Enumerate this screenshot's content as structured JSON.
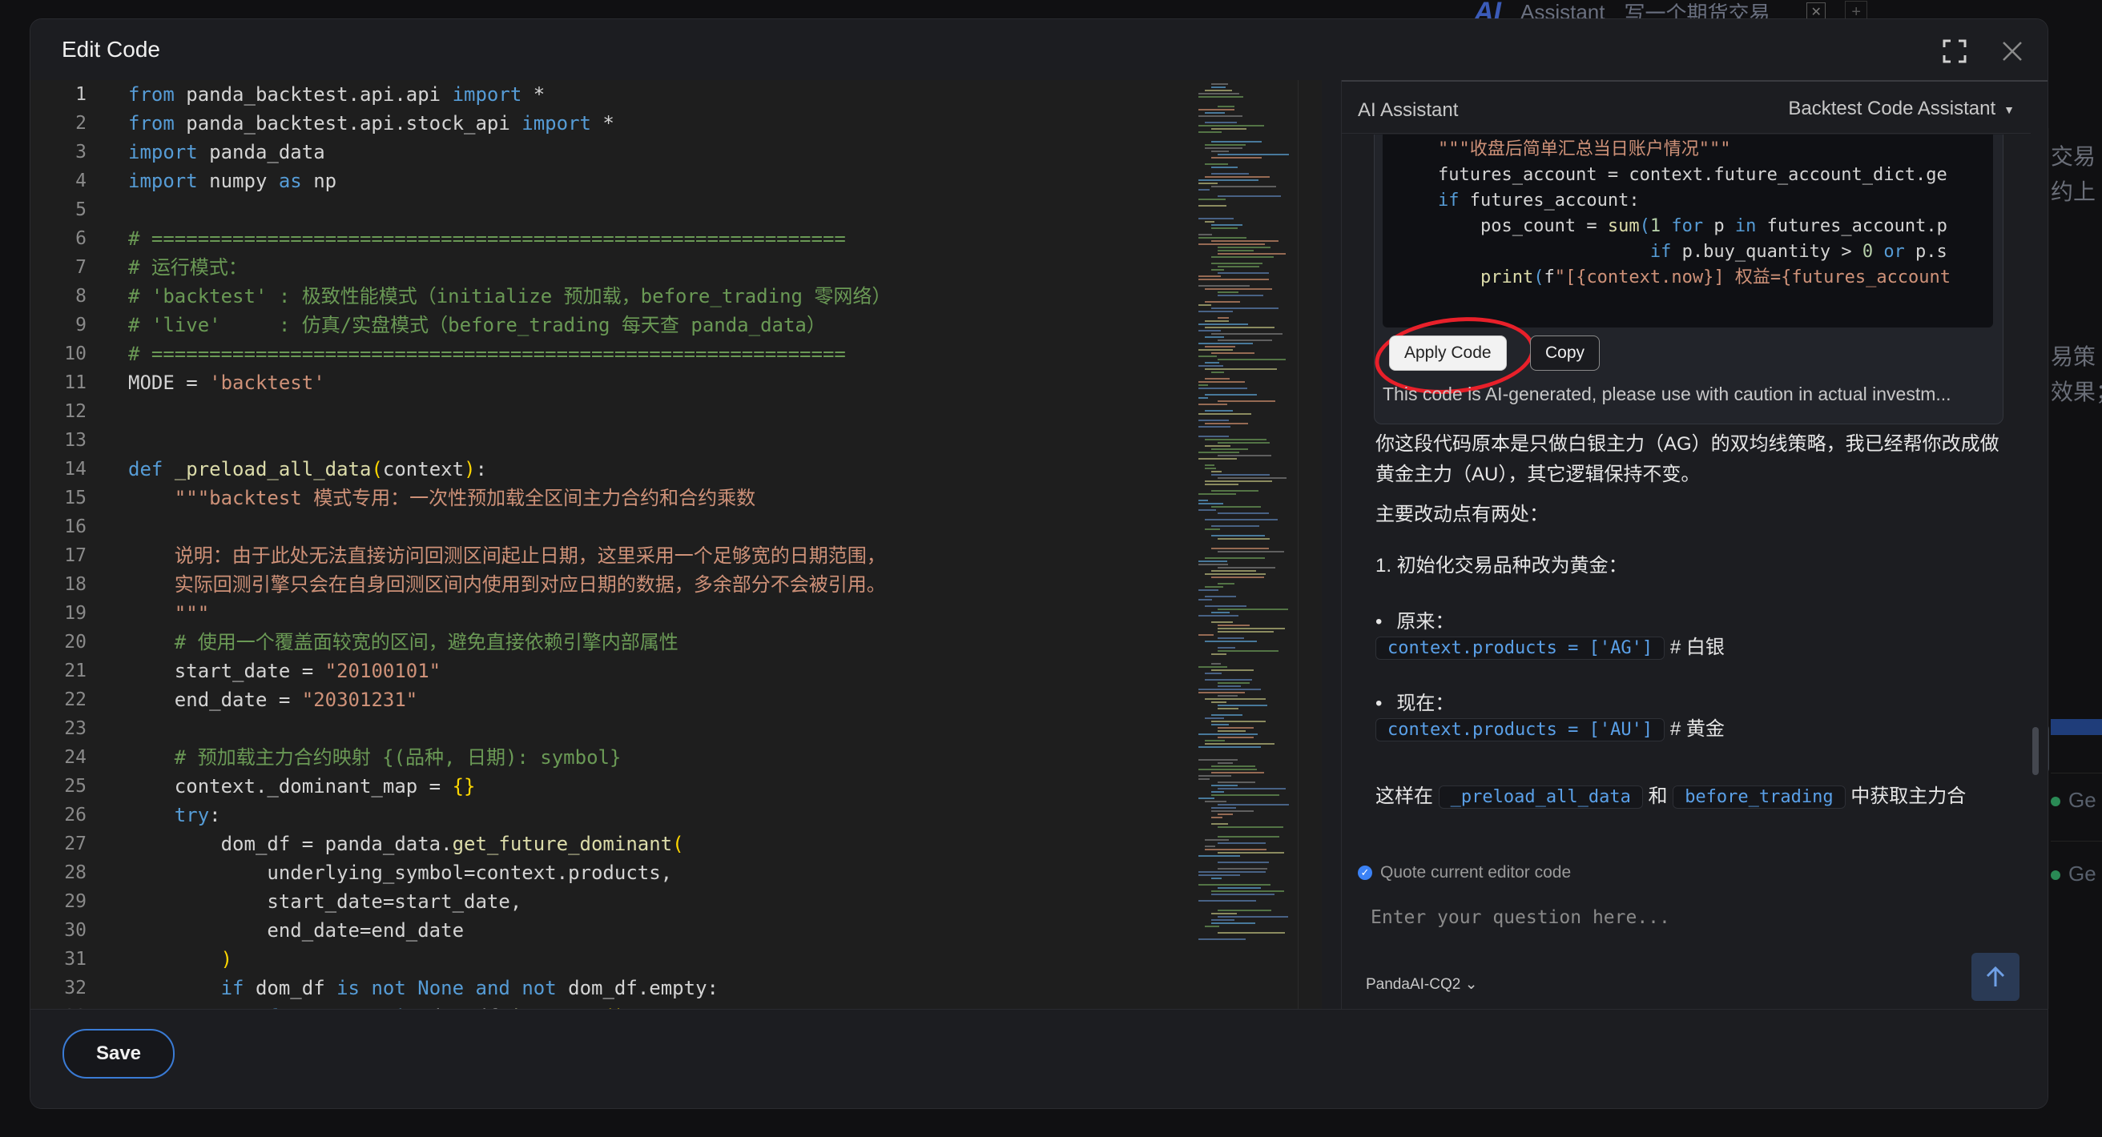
{
  "background": {
    "tabs": [
      "AI",
      "Assistant",
      "写一个期货交易..."
    ],
    "right_texts": [
      "交易",
      "约上",
      "易策",
      "效果；"
    ],
    "ge_items": [
      "Ge",
      "Ge"
    ]
  },
  "modal": {
    "title": "Edit Code",
    "save_label": "Save"
  },
  "editor": {
    "lines": [
      "from panda_backtest.api.api import *",
      "from panda_backtest.api.stock_api import *",
      "import panda_data",
      "import numpy as np",
      "",
      "# ============================================================",
      "# 运行模式：",
      "# 'backtest' : 极致性能模式（initialize 预加载，before_trading 零网络）",
      "# 'live'     : 仿真/实盘模式（before_trading 每天查 panda_data）",
      "# ============================================================",
      "MODE = 'backtest'",
      "",
      "",
      "def _preload_all_data(context):",
      "    \"\"\"backtest 模式专用：一次性预加载全区间主力合约和合约乘数",
      "",
      "    说明：由于此处无法直接访问回测区间起止日期，这里采用一个足够宽的日期范围，",
      "    实际回测引擎只会在自身回测区间内使用到对应日期的数据，多余部分不会被引用。",
      "    \"\"\"",
      "    # 使用一个覆盖面较宽的区间，避免直接依赖引擎内部属性",
      "    start_date = \"20100101\"",
      "    end_date = \"20301231\"",
      "",
      "    # 预加载主力合约映射 {(品种, 日期): symbol}",
      "    context._dominant_map = {}",
      "    try:",
      "        dom_df = panda_data.get_future_dominant(",
      "            underlying_symbol=context.products,",
      "            start_date=start_date,",
      "            end_date=end_date",
      "        )",
      "        if dom_df is not None and not dom_df.empty:",
      "            for _, row in dom_df.iterrows():"
    ]
  },
  "ai": {
    "title": "AI Assistant",
    "assistant_selector": "Backtest Code Assistant",
    "code_lines": [
      "def after_trading(context):",
      "    \"\"\"收盘后简单汇总当日账户情况\"\"\"",
      "    futures_account = context.future_account_dict.ge",
      "    if futures_account:",
      "        pos_count = sum(1 for p in futures_account.p",
      "                        if p.buy_quantity > 0 or p.s",
      "        print(f\"[{context.now}] 权益={futures_account"
    ],
    "apply_label": "Apply Code",
    "copy_label": "Copy",
    "disclaimer": "This code is AI-generated, please use with caution in actual investm...",
    "msg_intro": "你这段代码原本是只做白银主力（AG）的双均线策略，我已经帮你改成做黄金主力（AU），其它逻辑保持不变。",
    "msg_changes": "主要改动点有两处：",
    "msg_item1": "1. 初始化交易品种改为黄金：",
    "orig_label": "原来：",
    "orig_code": "context.products = ['AG']",
    "orig_comment": "# 白银",
    "now_label": "现在：",
    "now_code": "context.products = ['AU']",
    "now_comment": "# 黄金",
    "msg_tail_pre": "这样在",
    "msg_tail_code1": "_preload_all_data",
    "msg_tail_mid": "和",
    "msg_tail_code2": "before_trading",
    "msg_tail_post": "中获取主力合",
    "quote_label": "Quote current editor code",
    "input_placeholder": "Enter your question here...",
    "model": "PandaAI-CQ2"
  }
}
